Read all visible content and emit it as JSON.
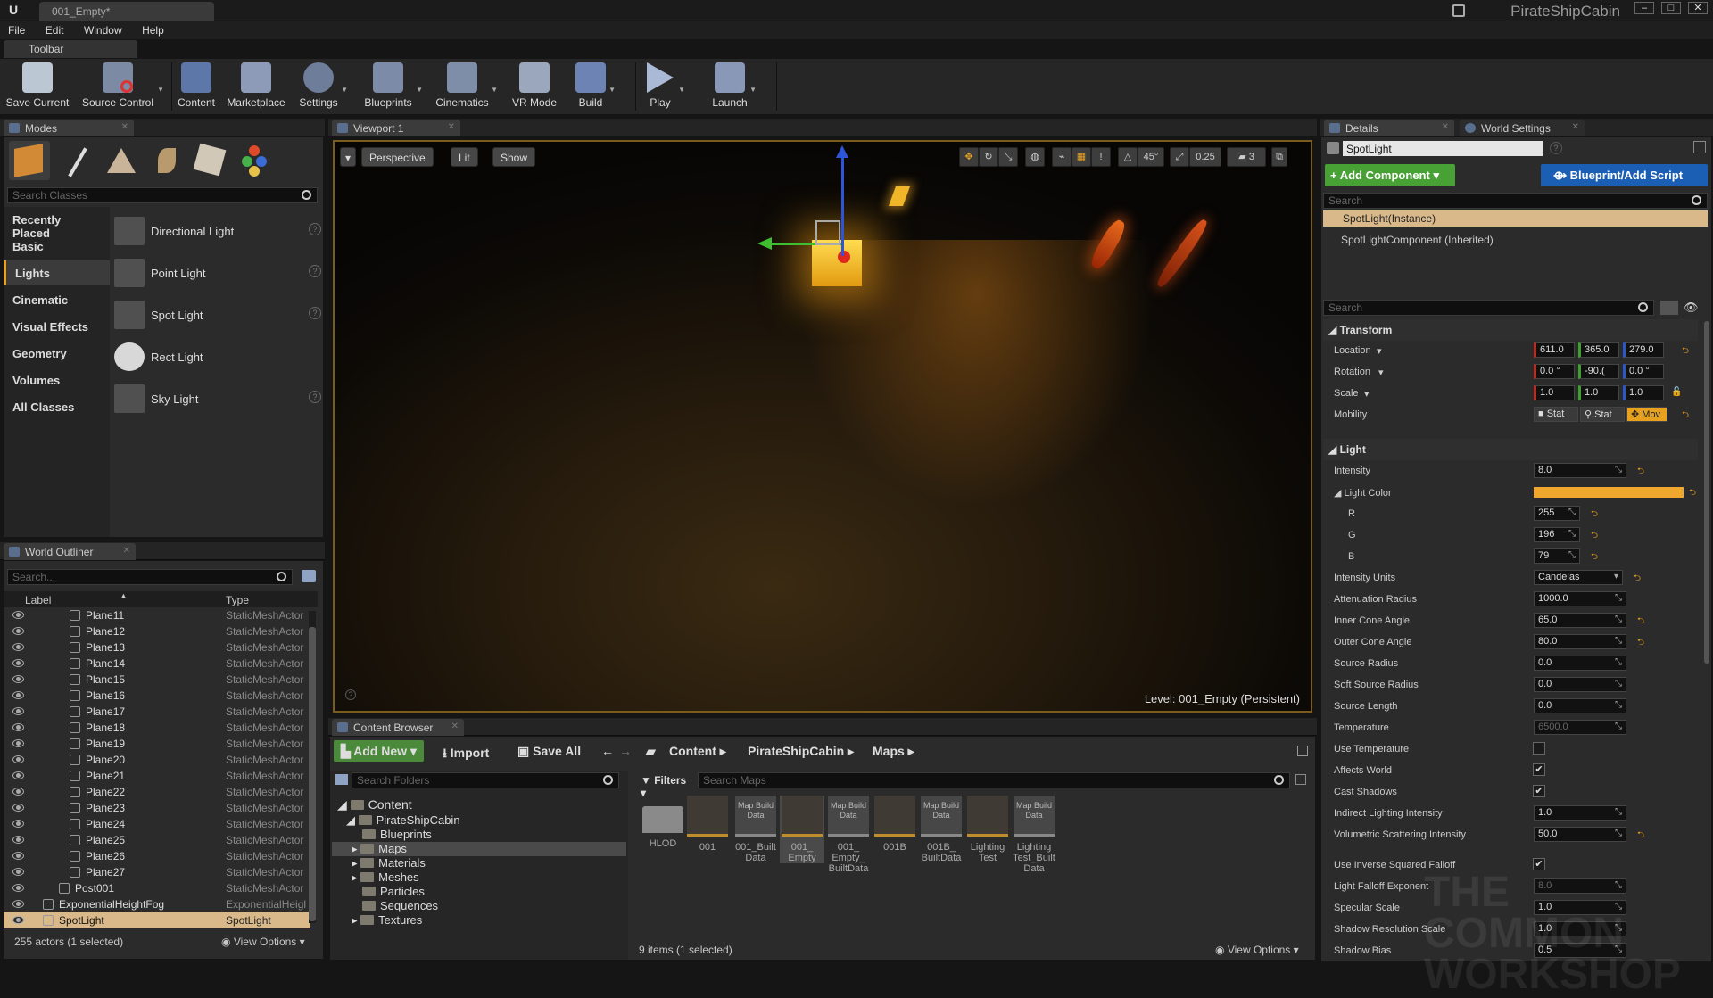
{
  "window": {
    "doc_tab": "001_Empty*",
    "project": "PirateShipCabin"
  },
  "menu": [
    "File",
    "Edit",
    "Window",
    "Help"
  ],
  "toolbar": {
    "tab": "Toolbar",
    "tools": [
      "Save Current",
      "Source Control",
      "Content",
      "Marketplace",
      "Settings",
      "Blueprints",
      "Cinematics",
      "VR Mode",
      "Build",
      "Play",
      "Launch"
    ]
  },
  "modes": {
    "tab": "Modes",
    "search_placeholder": "Search Classes",
    "categories": [
      "Recently Placed",
      "Basic",
      "Lights",
      "Cinematic",
      "Visual Effects",
      "Geometry",
      "Volumes",
      "All Classes"
    ],
    "selected_category": "Lights",
    "items": [
      "Directional Light",
      "Point Light",
      "Spot Light",
      "Rect Light",
      "Sky Light"
    ]
  },
  "outliner": {
    "tab": "World Outliner",
    "search_placeholder": "Search...",
    "col_label": "Label",
    "col_type": "Type",
    "rows": [
      {
        "label": "Plane11",
        "type": "StaticMeshActor"
      },
      {
        "label": "Plane12",
        "type": "StaticMeshActor"
      },
      {
        "label": "Plane13",
        "type": "StaticMeshActor"
      },
      {
        "label": "Plane14",
        "type": "StaticMeshActor"
      },
      {
        "label": "Plane15",
        "type": "StaticMeshActor"
      },
      {
        "label": "Plane16",
        "type": "StaticMeshActor"
      },
      {
        "label": "Plane17",
        "type": "StaticMeshActor"
      },
      {
        "label": "Plane18",
        "type": "StaticMeshActor"
      },
      {
        "label": "Plane19",
        "type": "StaticMeshActor"
      },
      {
        "label": "Plane20",
        "type": "StaticMeshActor"
      },
      {
        "label": "Plane21",
        "type": "StaticMeshActor"
      },
      {
        "label": "Plane22",
        "type": "StaticMeshActor"
      },
      {
        "label": "Plane23",
        "type": "StaticMeshActor"
      },
      {
        "label": "Plane24",
        "type": "StaticMeshActor"
      },
      {
        "label": "Plane25",
        "type": "StaticMeshActor"
      },
      {
        "label": "Plane26",
        "type": "StaticMeshActor"
      },
      {
        "label": "Plane27",
        "type": "StaticMeshActor"
      },
      {
        "label": "Post001",
        "type": "StaticMeshActor"
      },
      {
        "label": "ExponentialHeightFog",
        "type": "ExponentialHeigl"
      },
      {
        "label": "SpotLight",
        "type": "SpotLight"
      }
    ],
    "status": "255 actors (1 selected)",
    "view_options": "View Options"
  },
  "viewport": {
    "tab": "Viewport 1",
    "perspective": "Perspective",
    "lit": "Lit",
    "show": "Show",
    "angle": "45°",
    "scale": "0.25",
    "cam_speed": "3",
    "level_label": "Level:",
    "level_name": "001_Empty (Persistent)"
  },
  "content_browser": {
    "tab": "Content Browser",
    "add_new": "Add New",
    "import": "Import",
    "save_all": "Save All",
    "path": [
      "Content",
      "PirateShipCabin",
      "Maps"
    ],
    "search_folders": "Search Folders",
    "filters": "Filters",
    "search_maps": "Search Maps",
    "tree": [
      "Content",
      "PirateShipCabin",
      "Blueprints",
      "Maps",
      "Materials",
      "Meshes",
      "Particles",
      "Sequences",
      "Textures"
    ],
    "assets": [
      {
        "thumb": "",
        "name": "HLOD"
      },
      {
        "thumb": "",
        "name": "001"
      },
      {
        "thumb": "Map Build Data",
        "name": "001_Built Data"
      },
      {
        "thumb": "",
        "name": "001_ Empty"
      },
      {
        "thumb": "Map Build Data",
        "name": "001_ Empty_ BuiltData"
      },
      {
        "thumb": "",
        "name": "001B"
      },
      {
        "thumb": "Map Build Data",
        "name": "001B_ BuiltData"
      },
      {
        "thumb": "",
        "name": "Lighting Test"
      },
      {
        "thumb": "Map Build Data",
        "name": "Lighting Test_Built Data"
      }
    ],
    "status": "9 items (1 selected)",
    "view_options": "View Options"
  },
  "details": {
    "tab": "Details",
    "tab2": "World Settings",
    "actor_name": "SpotLight",
    "add_component": "+ Add Component",
    "blueprint": "Blueprint/Add Script",
    "search_placeholder": "Search",
    "instance": "SpotLight(Instance)",
    "component": "SpotLightComponent (Inherited)",
    "search2": "Search",
    "transform": {
      "title": "Transform",
      "location_label": "Location",
      "location": [
        "611.0",
        "365.0",
        "279.0"
      ],
      "rotation_label": "Rotation",
      "rotation": [
        "0.0 °",
        "-90.(",
        "0.0 °"
      ],
      "scale_label": "Scale",
      "scale": [
        "1.0",
        "1.0",
        "1.0"
      ],
      "mobility_label": "Mobility",
      "mobility": [
        "Stat",
        "Stat",
        "Mov"
      ]
    },
    "light": {
      "title": "Light",
      "props": [
        {
          "label": "Intensity",
          "value": "8.0"
        },
        {
          "label": "Light Color",
          "value": ""
        },
        {
          "label": "R",
          "value": "255"
        },
        {
          "label": "G",
          "value": "196"
        },
        {
          "label": "B",
          "value": "79"
        },
        {
          "label": "Intensity Units",
          "value": "Candelas"
        },
        {
          "label": "Attenuation Radius",
          "value": "1000.0"
        },
        {
          "label": "Inner Cone Angle",
          "value": "65.0"
        },
        {
          "label": "Outer Cone Angle",
          "value": "80.0"
        },
        {
          "label": "Source Radius",
          "value": "0.0"
        },
        {
          "label": "Soft Source Radius",
          "value": "0.0"
        },
        {
          "label": "Source Length",
          "value": "0.0"
        },
        {
          "label": "Temperature",
          "value": "6500.0"
        },
        {
          "label": "Use Temperature",
          "value": ""
        },
        {
          "label": "Affects World",
          "value": ""
        },
        {
          "label": "Cast Shadows",
          "value": ""
        },
        {
          "label": "Indirect Lighting Intensity",
          "value": "1.0"
        },
        {
          "label": "Volumetric Scattering Intensity",
          "value": "50.0"
        },
        {
          "label": "Use Inverse Squared Falloff",
          "value": ""
        },
        {
          "label": "Light Falloff Exponent",
          "value": "8.0"
        },
        {
          "label": "Specular Scale",
          "value": "1.0"
        },
        {
          "label": "Shadow Resolution Scale",
          "value": "1.0"
        },
        {
          "label": "Shadow Bias",
          "value": "0.5"
        }
      ]
    },
    "light_color": "#f0a72e",
    "watermark": "THE COMMON WORKSHOP"
  },
  "colors": {
    "accent": "#e8a11f",
    "green": "#48a134",
    "blue": "#1a5fb4"
  }
}
